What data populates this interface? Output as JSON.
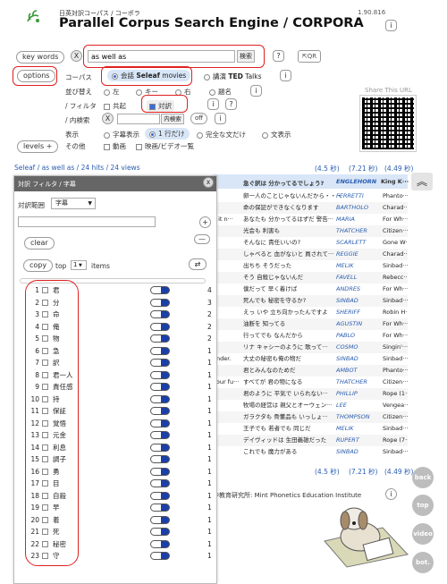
{
  "header": {
    "subtitle": "日英対訳コーパス / コーポラ",
    "title": "Parallel Corpus Search Engine / CORPORA",
    "version": "1.90.816",
    "info": "i"
  },
  "search": {
    "keywords_label": "key words",
    "x": "X",
    "query": "as well as",
    "search_button": "検索",
    "help": "?",
    "qr_label": "QR"
  },
  "options": {
    "options_label": "options",
    "corpus_label": "コーパス",
    "corpus_seleaf_prefix": "会話",
    "corpus_seleaf": "Seleaf",
    "corpus_seleaf_suffix": "movies",
    "corpus_ted_prefix": "講演",
    "corpus_ted": "TED",
    "corpus_ted_suffix": "Talks",
    "sort_label": "並び替え",
    "sort_left": "左",
    "sort_key": "キー",
    "sort_right": "右",
    "sort_title": "題名",
    "filter_label": "/ フィルタ",
    "filter_common": "共起",
    "filter_parallel": "対訳",
    "inner_label": "/ 内検索",
    "inner_x": "X",
    "inner_button": "内検索",
    "inner_off": "off",
    "display_label": "表示",
    "display_subs": "字幕表示",
    "display_one": "1 行だけ",
    "display_full": "完全な文だけ",
    "display_ctx": "文表示",
    "other_label": "その他",
    "other_video": "動画",
    "other_list": "映画/ビデオ一覧",
    "levels": "levels +",
    "share": "Share This URL"
  },
  "results": {
    "breadcrumb": "Seleaf / as well as / 24 hits / 24 views",
    "time1": "(4.5 秒)",
    "time2": "(7.21 秒)",
    "time3": "(4.49 秒)",
    "header_ja": "急ぐ訳は 分かってるでしょう?",
    "header_sp": "ENGLEHORN",
    "header_mv": "King K···",
    "rows": [
      {
        "en": "",
        "ja": "卵一人のことじゃないんだから・・・",
        "sp": "FERRETTI",
        "mv": "Phanto···"
      },
      {
        "en": "",
        "ja": "命の保証ができなくなります",
        "sp": "BARTHOLO",
        "mv": "Charad···"
      },
      {
        "en": "e it n···",
        "ja": "あなたも 分かってるはずだ 警告···",
        "sp": "MARIA",
        "mv": "For Wh···"
      },
      {
        "en": "",
        "ja": "光会も 利害も",
        "sp": "THATCHER",
        "mv": "Citizen···"
      },
      {
        "en": "",
        "ja": "そんなに 責任いいの?",
        "sp": "SCARLETT",
        "mv": "Gone W···"
      },
      {
        "en": "",
        "ja": "しゃべると 血がないと 員されて···",
        "sp": "REGGIE",
        "mv": "Charad···"
      },
      {
        "en": "",
        "ja": "出ちち そうだった",
        "sp": "MELIK",
        "mv": "Sinbad···"
      },
      {
        "en": "",
        "ja": "そう 自殺じゃないんだ",
        "sp": "FAVELL",
        "mv": "Rebecc···"
      },
      {
        "en": "",
        "ja": "僕だって 早く着けば",
        "sp": "ANDRES",
        "mv": "For Wh···"
      },
      {
        "en": "",
        "ja": "死んでも 秘密を守るか?",
        "sp": "SINBAD",
        "mv": "Sinbad···"
      },
      {
        "en": "",
        "ja": "えっ いや 立ち向かったんですよ",
        "sp": "SHERIFF",
        "mv": "Robin H···"
      },
      {
        "en": "",
        "ja": "油断を 知ってる",
        "sp": "AGUSTIN",
        "mv": "For Wh···"
      },
      {
        "en": "",
        "ja": "行ってでも なんだから",
        "sp": "PABLO",
        "mv": "For Wh···"
      },
      {
        "en": "",
        "ja": "リナ キャシーのように 歌って···",
        "sp": "COSMO",
        "mv": "Singin'···"
      },
      {
        "en": "ander.",
        "ja": "大丈の秘密も俺の物だ",
        "sp": "SINBAD",
        "mv": "Sinbad···"
      },
      {
        "en": "",
        "ja": "君とみんなのためだ",
        "sp": "AMBOT",
        "mv": "Phanto···"
      },
      {
        "en": "your fu···",
        "ja": "すべてが 君の物になる",
        "sp": "THATCHER",
        "mv": "Citizen···"
      },
      {
        "en": "",
        "ja": "君のように 平気で いられない···",
        "sp": "PHILLIP",
        "mv": "Rope (1···"
      },
      {
        "en": "",
        "ja": "牧場の経営は 親父とオーウェン···",
        "sp": "LEE",
        "mv": "Vengea···"
      },
      {
        "en": "",
        "ja": "ガラクタも 骨董品も いっしょ···",
        "sp": "THOMPSON",
        "mv": "Citizen···"
      },
      {
        "en": "",
        "ja": "王子でも 若者でも 同じだ",
        "sp": "MELIK",
        "mv": "Sinbad···"
      },
      {
        "en": "",
        "ja": "デイヴィッドは 生田義雄だった",
        "sp": "RUPERT",
        "mv": "Rope (7···"
      },
      {
        "en": "",
        "ja": "これでも 魔力がある",
        "sp": "SINBAD",
        "mv": "Sinbad···"
      }
    ],
    "footer_institute": "中教育研究所: Mint Phonetics Education Institute",
    "footer_info": "i"
  },
  "filter_panel": {
    "title": "対訳 フィルタ / 字幕",
    "close": "x",
    "range_label": "対訳範囲",
    "range_value": "字幕",
    "plus": "+",
    "clear": "clear",
    "minus": "—",
    "copy": "copy",
    "top_label": "top",
    "top_value": "1",
    "items_label": "items",
    "items": [
      {
        "n": "1",
        "w": "君",
        "q": "4"
      },
      {
        "n": "2",
        "w": "分",
        "q": "3"
      },
      {
        "n": "3",
        "w": "命",
        "q": "2"
      },
      {
        "n": "4",
        "w": "俺",
        "q": "2"
      },
      {
        "n": "5",
        "w": "物",
        "q": "2"
      },
      {
        "n": "6",
        "w": "急",
        "q": "1"
      },
      {
        "n": "7",
        "w": "訳",
        "q": "1"
      },
      {
        "n": "8",
        "w": "君一人",
        "q": "1"
      },
      {
        "n": "9",
        "w": "責任感",
        "q": "1"
      },
      {
        "n": "10",
        "w": "持",
        "q": "1"
      },
      {
        "n": "11",
        "w": "保証",
        "q": "1"
      },
      {
        "n": "12",
        "w": "覚悟",
        "q": "1"
      },
      {
        "n": "13",
        "w": "元金",
        "q": "1"
      },
      {
        "n": "14",
        "w": "利息",
        "q": "1"
      },
      {
        "n": "15",
        "w": "調子",
        "q": "1"
      },
      {
        "n": "16",
        "w": "勇",
        "q": "1"
      },
      {
        "n": "17",
        "w": "目",
        "q": "1"
      },
      {
        "n": "18",
        "w": "自殺",
        "q": "1"
      },
      {
        "n": "19",
        "w": "早",
        "q": "1"
      },
      {
        "n": "20",
        "w": "着",
        "q": "1"
      },
      {
        "n": "21",
        "w": "死",
        "q": "1"
      },
      {
        "n": "22",
        "w": "秘密",
        "q": "1"
      },
      {
        "n": "23",
        "w": "守",
        "q": "1"
      }
    ]
  },
  "sidebar": {
    "back": "back",
    "top": "top",
    "video": "video",
    "bot": "bot."
  }
}
